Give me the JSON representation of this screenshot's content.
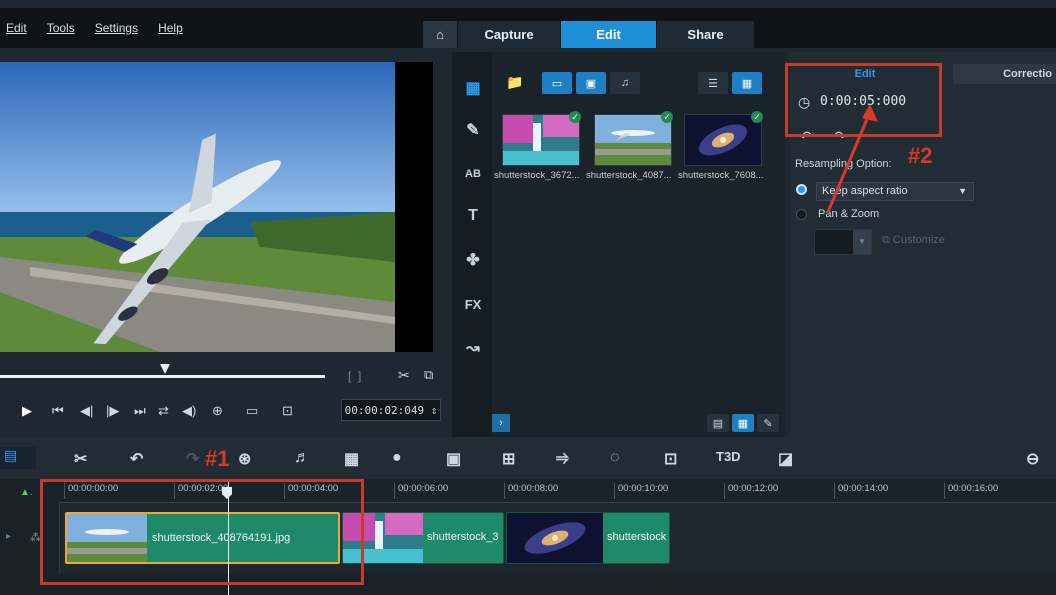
{
  "menu": [
    "Edit",
    "Tools",
    "Settings",
    "Help"
  ],
  "nav": {
    "home": "⌂",
    "capture": "Capture",
    "edit": "Edit",
    "share": "Share"
  },
  "preview": {
    "timecode": "00:00:02:049 ⇕"
  },
  "library": {
    "thumbs": [
      {
        "label": "shutterstock_3672..."
      },
      {
        "label": "shutterstock_4087..."
      },
      {
        "label": "shutterstock_7608..."
      }
    ]
  },
  "options": {
    "edit_tab": "Edit",
    "correction_tab": "Correctio",
    "duration": "0:00:05:000",
    "resampling_label": "Resampling Option:",
    "keep_aspect": "Keep aspect ratio",
    "pan_zoom": "Pan & Zoom",
    "customize": "Customize"
  },
  "annotations": {
    "one": "#1",
    "two": "#2"
  },
  "ruler": [
    "00:00:00:00",
    "00:00:02:00",
    "00:00:04:00",
    "00:00:06:00",
    "00:00:08:00",
    "00:00:10:00",
    "00:00:12:00",
    "00:00:14:00",
    "00:00:16:00"
  ],
  "clips": [
    {
      "label": "shutterstock_408764191.jpg"
    },
    {
      "label": "shutterstock_3"
    },
    {
      "label": "shutterstock"
    }
  ],
  "colors": {
    "accent": "#1f8fd9",
    "clip": "#1f8a68",
    "annotation": "#c83a2c"
  }
}
